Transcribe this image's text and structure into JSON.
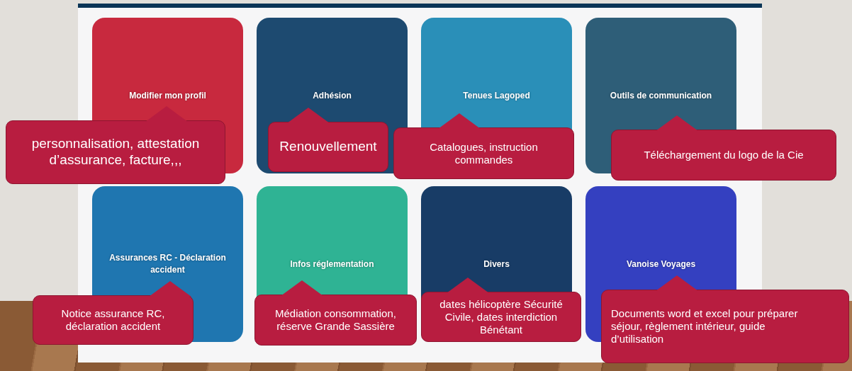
{
  "tiles": [
    {
      "title": "Modifier mon profil",
      "color": "#c8293e",
      "callout": "personnalisation, attestation d’assurance, facture,,,"
    },
    {
      "title": "Adhésion",
      "color": "#1d4a70",
      "callout": "Renouvellement"
    },
    {
      "title": "Tenues Lagoped",
      "color": "#2a8fb8",
      "callout": "Catalogues, instruction commandes"
    },
    {
      "title": "Outils de communication",
      "color": "#2e5e78",
      "callout": "Téléchargement du logo de la Cie"
    },
    {
      "title": "Assurances RC - Déclaration accident",
      "color": "#1f76b0",
      "callout": "Notice assurance RC, déclaration accident"
    },
    {
      "title": "Infos réglementation",
      "color": "#2fb394",
      "callout": "Médiation consommation, réserve Grande Sassière"
    },
    {
      "title": "Divers",
      "color": "#183c66",
      "callout": "dates hélicoptère Sécurité Civile, dates interdiction Bénétant"
    },
    {
      "title": "Vanoise Voyages",
      "color": "#3440c0",
      "callout": "Documents word et excel pour préparer séjour, règlement intérieur, guide d’utilisation"
    }
  ]
}
